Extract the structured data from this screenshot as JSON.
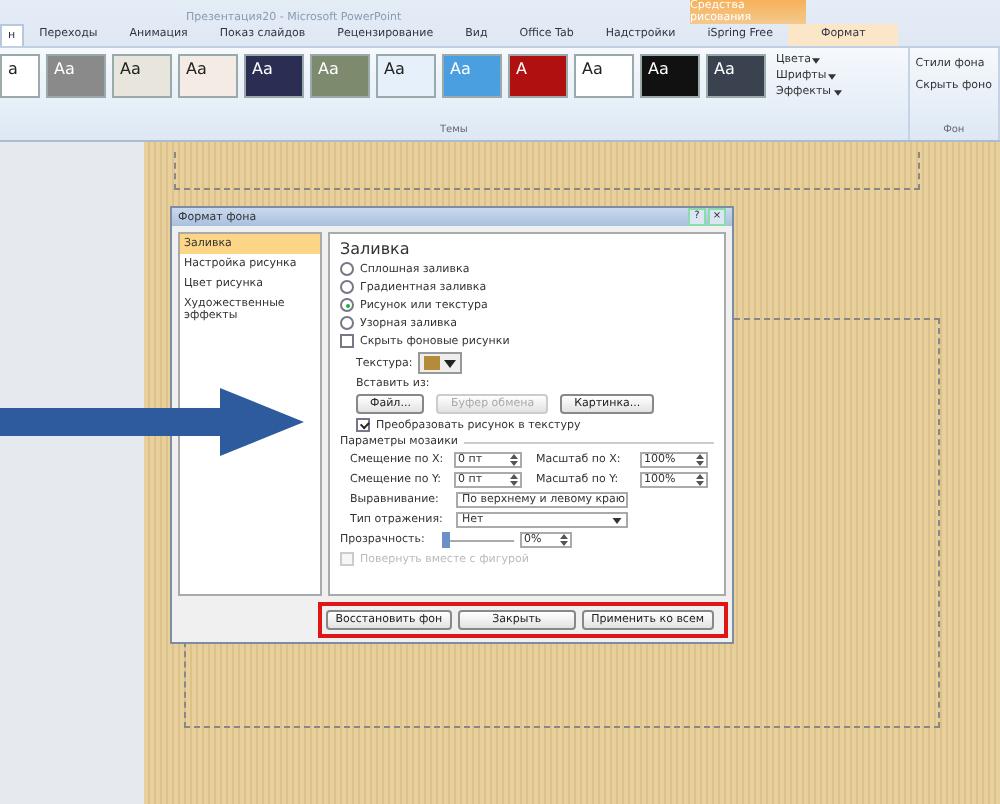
{
  "window": {
    "title": "Презентация20 - Microsoft PowerPoint",
    "contextual_tab": "Средства рисования"
  },
  "tabs": [
    {
      "label": "н",
      "selected": true
    },
    {
      "label": "Переходы",
      "selected": false
    },
    {
      "label": "Анимация",
      "selected": false
    },
    {
      "label": "Показ слайдов",
      "selected": false
    },
    {
      "label": "Рецензирование",
      "selected": false
    },
    {
      "label": "Вид",
      "selected": false
    },
    {
      "label": "Office Tab",
      "selected": false
    },
    {
      "label": "Надстройки",
      "selected": false
    },
    {
      "label": "iSpring Free",
      "selected": false
    },
    {
      "label": "Формат",
      "selected": false
    }
  ],
  "themes": {
    "label": "Темы",
    "items": [
      {
        "sample": "a",
        "color": "#ffffff"
      },
      {
        "sample": "Aa",
        "color": "#8a8a8a"
      },
      {
        "sample": "Aa",
        "color": "#e8e6dc"
      },
      {
        "sample": "Aa",
        "color": "#f4ece4"
      },
      {
        "sample": "Aa",
        "color": "#2b2d52"
      },
      {
        "sample": "Aa",
        "color": "#7d8a6e"
      },
      {
        "sample": "Aa",
        "color": "#e6f0fa"
      },
      {
        "sample": "Aa",
        "color": "#4a9fe0"
      },
      {
        "sample": "A",
        "color": "#b01010"
      },
      {
        "sample": "Aa",
        "color": "#ffffff"
      },
      {
        "sample": "Aa",
        "color": "#111111"
      },
      {
        "sample": "Aa",
        "color": "#3a4250"
      }
    ],
    "commands": [
      "Цвета",
      "Шрифты",
      "Эффекты"
    ]
  },
  "background_group": {
    "label": "Фон",
    "commands": [
      "Стили фона",
      "Скрыть фоно"
    ]
  },
  "dialog": {
    "title": "Формат фона",
    "title_buttons": [
      "?",
      "×"
    ],
    "nav": [
      {
        "label": "Заливка",
        "selected": true
      },
      {
        "label": "Настройка рисунка",
        "selected": false
      },
      {
        "label": "Цвет рисунка",
        "selected": false
      },
      {
        "label": "Художественные эффекты",
        "selected": false
      }
    ],
    "heading": "Заливка",
    "fill_options": [
      {
        "label": "Сплошная заливка",
        "selected": false
      },
      {
        "label": "Градиентная заливка",
        "selected": false
      },
      {
        "label": "Рисунок или текстура",
        "selected": true
      },
      {
        "label": "Узорная заливка",
        "selected": false
      }
    ],
    "hide_background": {
      "label": "Скрыть фоновые рисунки",
      "checked": false
    },
    "texture_label": "Текстура:",
    "insert_from": "Вставить из:",
    "insert_buttons": [
      {
        "label": "Файл...",
        "disabled": false
      },
      {
        "label": "Буфер обмена",
        "disabled": true
      },
      {
        "label": "Картинка...",
        "disabled": false
      }
    ],
    "tile": {
      "label": "Преобразовать рисунок в текстуру",
      "checked": true
    },
    "tiling_heading": "Параметры мозаики",
    "spinners": [
      {
        "label": "Смещение по X:",
        "value": "0 пт"
      },
      {
        "label": "Масштаб по X:",
        "value": "100%"
      },
      {
        "label": "Смещение по Y:",
        "value": "0 пт"
      },
      {
        "label": "Масштаб по Y:",
        "value": "100%"
      }
    ],
    "dropdowns": [
      {
        "label": "Выравнивание:",
        "value": "По верхнему и левому краю"
      },
      {
        "label": "Тип отражения:",
        "value": "Нет"
      }
    ],
    "transparency": {
      "label": "Прозрачность:",
      "level": 0,
      "value": "0%"
    },
    "rotate": {
      "label": "Повернуть вместе с фигурой",
      "checked": false,
      "disabled": true
    },
    "buttons": [
      "Восстановить фон",
      "Закрыть",
      "Применить ко всем"
    ]
  }
}
